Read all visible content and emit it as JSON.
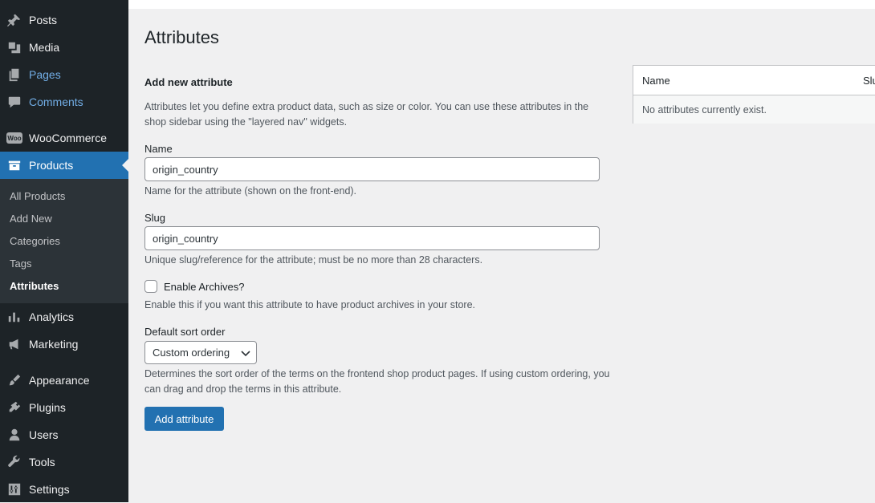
{
  "sidebar": {
    "items": [
      {
        "label": "Posts",
        "icon": "pin-icon"
      },
      {
        "label": "Media",
        "icon": "media-icon"
      },
      {
        "label": "Pages",
        "icon": "pages-icon"
      },
      {
        "label": "Comments",
        "icon": "comments-icon"
      },
      {
        "label": "WooCommerce",
        "icon": "woocommerce-icon",
        "badge": "Woo"
      },
      {
        "label": "Products",
        "icon": "products-icon"
      },
      {
        "label": "Analytics",
        "icon": "analytics-icon"
      },
      {
        "label": "Marketing",
        "icon": "megaphone-icon"
      },
      {
        "label": "Appearance",
        "icon": "brush-icon"
      },
      {
        "label": "Plugins",
        "icon": "plugin-icon"
      },
      {
        "label": "Users",
        "icon": "user-icon"
      },
      {
        "label": "Tools",
        "icon": "wrench-icon"
      },
      {
        "label": "Settings",
        "icon": "settings-icon"
      }
    ],
    "products_submenu": [
      "All Products",
      "Add New",
      "Categories",
      "Tags",
      "Attributes"
    ]
  },
  "main": {
    "title": "Attributes",
    "form": {
      "heading": "Add new attribute",
      "intro": "Attributes let you define extra product data, such as size or color. You can use these attributes in the shop sidebar using the \"layered nav\" widgets.",
      "name_label": "Name",
      "name_value": "origin_country",
      "name_help": "Name for the attribute (shown on the front-end).",
      "slug_label": "Slug",
      "slug_value": "origin_country",
      "slug_help": "Unique slug/reference for the attribute; must be no more than 28 characters.",
      "archives_label": "Enable Archives?",
      "archives_checked": false,
      "archives_help": "Enable this if you want this attribute to have product archives in your store.",
      "sort_label": "Default sort order",
      "sort_value": "Custom ordering",
      "sort_help": "Determines the sort order of the terms on the frontend shop product pages. If using custom ordering, you can drag and drop the terms in this attribute.",
      "submit_label": "Add attribute"
    },
    "table": {
      "columns": [
        "Name",
        "Slu"
      ],
      "empty_message": "No attributes currently exist."
    }
  },
  "colors": {
    "sidebar_bg": "#1d2327",
    "submenu_bg": "#2c3338",
    "accent": "#2271b1",
    "link_blue": "#72aee6"
  }
}
